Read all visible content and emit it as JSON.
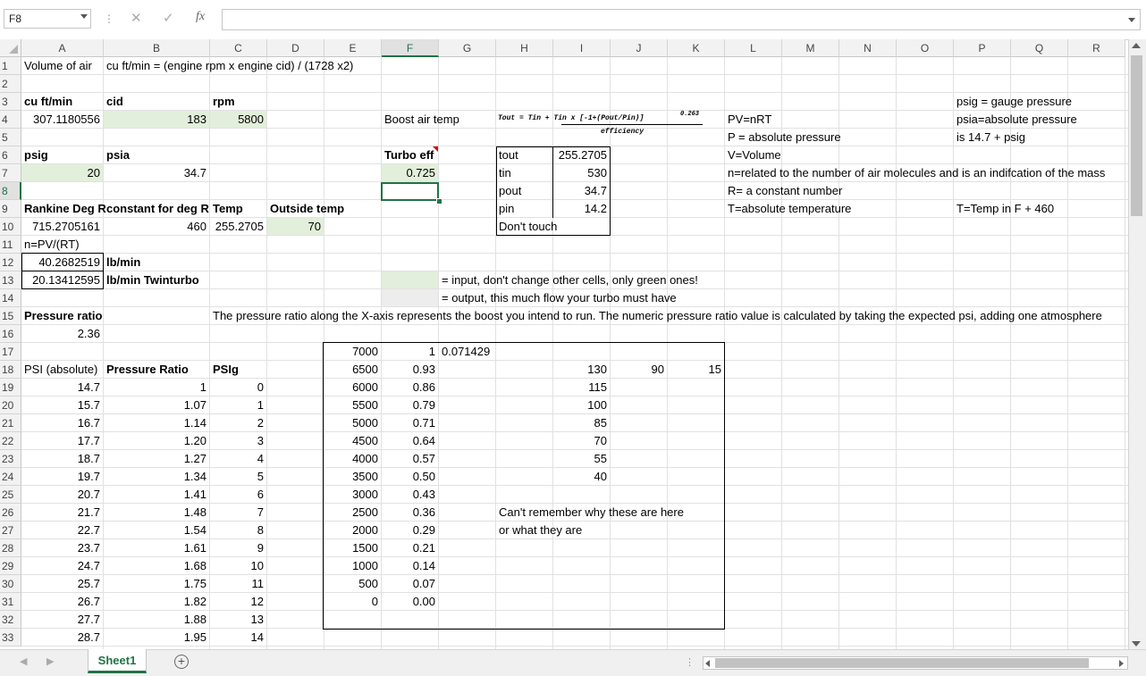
{
  "formula_bar": {
    "name_box": "F8",
    "cancel_icon": "x-icon",
    "enter_icon": "check-icon",
    "fx_label": "fx",
    "formula": ""
  },
  "columns": [
    "A",
    "B",
    "C",
    "D",
    "E",
    "F",
    "G",
    "H",
    "I",
    "J",
    "K",
    "L",
    "M",
    "N",
    "O",
    "P",
    "Q",
    "R"
  ],
  "selected_column": "F",
  "rows": [
    "1",
    "2",
    "3",
    "4",
    "5",
    "6",
    "7",
    "8",
    "9",
    "10",
    "11",
    "12",
    "13",
    "14",
    "15",
    "16",
    "17",
    "18",
    "19",
    "20",
    "21",
    "22",
    "23",
    "24",
    "25",
    "26",
    "27",
    "28",
    "29",
    "30",
    "31",
    "32",
    "33"
  ],
  "selected_row": "8",
  "colors": {
    "input_fill": "#e2efda",
    "output_fill": "#ededed",
    "accent": "#217346"
  },
  "formula_image": {
    "lhs": "Tout = Tin + Tin x [-1+(Pout/Pin)",
    "exponent": "0.263",
    "tail": "]",
    "denominator": "efficiency"
  },
  "cells": {
    "A1": "Volume of air",
    "B1": "cu ft/min = (engine rpm x engine cid) / (1728 x2)",
    "A3": "cu ft/min",
    "B3": "cid",
    "C3": "rpm",
    "P3": "psig = gauge pressure",
    "A4": "307.1180556",
    "B4": "183",
    "C4": "5800",
    "F4": "Boost air temp",
    "L4": "PV=nRT",
    "P4": "psia=absolute pressure",
    "L5": "P = absolute pressure",
    "P5": "is 14.7 + psig",
    "A6": "psig",
    "B6": "psia",
    "F6": "Turbo eff",
    "H6": "tout",
    "I6": "255.2705",
    "L6": "V=Volume",
    "A7": "20",
    "B7": "34.7",
    "F7": "0.725",
    "H7": "tin",
    "I7": "530",
    "L7": "n=related to the number of air molecules and is an indifcation of the mass",
    "H8": "pout",
    "I8": "34.7",
    "L8": "R= a constant number",
    "A9": "Rankine Deg R",
    "B9": "constant for deg R",
    "C9": "Temp",
    "D9": "Outside temp",
    "H9": "pin",
    "I9": "14.2",
    "L9": "T=absolute temperature",
    "P9": "T=Temp in F + 460",
    "A10": "715.2705161",
    "B10": "460",
    "C10": "255.2705",
    "D10": "70",
    "H10": "Don't touch",
    "A11": "n=PV/(RT)",
    "A12": "40.2682519",
    "B12": "lb/min",
    "A13": "20.13412595",
    "B13": "lb/min Twinturbo",
    "G13": "= input, don't change other cells, only green ones!",
    "G14": "= output, this much flow your turbo must have",
    "A15": "Pressure ratio",
    "C15": "The pressure ratio along the X-axis represents the boost you intend to run. The numeric pressure ratio value is calculated by taking the expected psi, adding one atmosphere",
    "A16": "2.36",
    "E17": "7000",
    "F17": "1",
    "G17": "0.071429",
    "A18": "PSI (absolute)",
    "B18": "Pressure Ratio",
    "C18": "PSIg",
    "E18": "6500",
    "F18": "0.93",
    "I18": "130",
    "J18": "90",
    "K18": "15",
    "A19": "14.7",
    "B19": "1",
    "C19": "0",
    "E19": "6000",
    "F19": "0.86",
    "I19": "115",
    "A20": "15.7",
    "B20": "1.07",
    "C20": "1",
    "E20": "5500",
    "F20": "0.79",
    "I20": "100",
    "A21": "16.7",
    "B21": "1.14",
    "C21": "2",
    "E21": "5000",
    "F21": "0.71",
    "I21": "85",
    "A22": "17.7",
    "B22": "1.20",
    "C22": "3",
    "E22": "4500",
    "F22": "0.64",
    "I22": "70",
    "A23": "18.7",
    "B23": "1.27",
    "C23": "4",
    "E23": "4000",
    "F23": "0.57",
    "I23": "55",
    "A24": "19.7",
    "B24": "1.34",
    "C24": "5",
    "E24": "3500",
    "F24": "0.50",
    "I24": "40",
    "A25": "20.7",
    "B25": "1.41",
    "C25": "6",
    "E25": "3000",
    "F25": "0.43",
    "A26": "21.7",
    "B26": "1.48",
    "C26": "7",
    "E26": "2500",
    "F26": "0.36",
    "H26": "Can't remember why these are here",
    "A27": "22.7",
    "B27": "1.54",
    "C27": "8",
    "E27": "2000",
    "F27": "0.29",
    "H27": "or what they are",
    "A28": "23.7",
    "B28": "1.61",
    "C28": "9",
    "E28": "1500",
    "F28": "0.21",
    "A29": "24.7",
    "B29": "1.68",
    "C29": "10",
    "E29": "1000",
    "F29": "0.14",
    "A30": "25.7",
    "B30": "1.75",
    "C30": "11",
    "E30": "500",
    "F30": "0.07",
    "A31": "26.7",
    "B31": "1.82",
    "C31": "12",
    "E31": "0",
    "F31": "0.00",
    "A32": "27.7",
    "B32": "1.88",
    "C32": "13",
    "A33": "28.7",
    "B33": "1.95",
    "C33": "14"
  },
  "sheet_tabs": [
    {
      "label": "Sheet1",
      "active": true
    }
  ],
  "add_sheet_icon": "plus-circle-icon"
}
